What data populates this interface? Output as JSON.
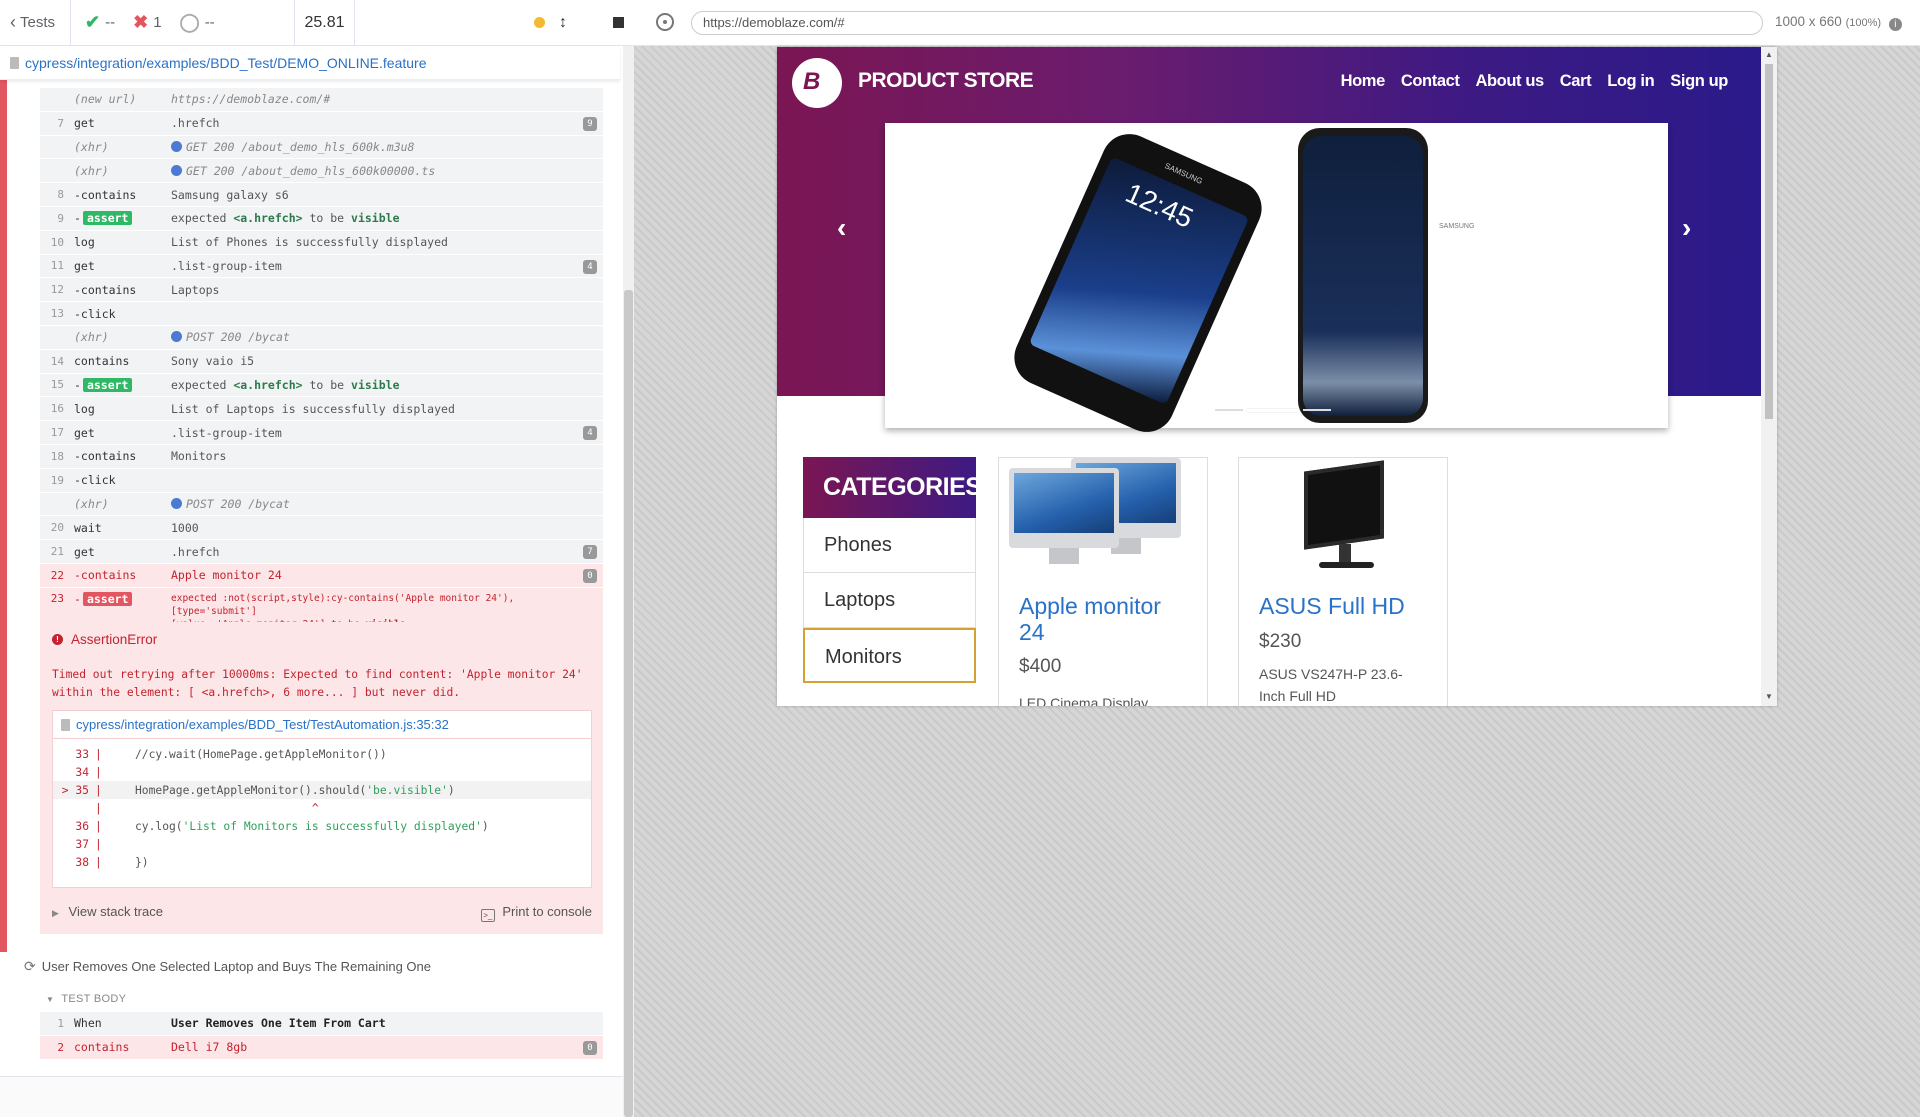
{
  "reporter": {
    "header": {
      "back_label": "Tests",
      "passed": "--",
      "failed": "1",
      "pending": "--",
      "duration": "25.81"
    },
    "spec_path": "cypress/integration/examples/BDD_Test/DEMO_ONLINE.feature",
    "commands": [
      {
        "num": "",
        "name": "(new url)",
        "msg": "https://demoblaze.com/#",
        "style": "it"
      },
      {
        "num": "7",
        "name": "get",
        "msg": ".hrefch",
        "badge": "9"
      },
      {
        "num": "",
        "name": "(xhr)",
        "msg": "GET 200 /about_demo_hls_600k.m3u8",
        "style": "xhr"
      },
      {
        "num": "",
        "name": "(xhr)",
        "msg": "GET 200 /about_demo_hls_600k00000.ts",
        "style": "xhr"
      },
      {
        "num": "8",
        "name": "-contains",
        "msg": "Samsung galaxy s6"
      },
      {
        "num": "9",
        "name": "-assert",
        "msg_pre": "expected",
        "msg_el": "<a.hrefch>",
        "msg_mid": "to be",
        "msg_end": "visible",
        "style": "assert"
      },
      {
        "num": "10",
        "name": "log",
        "msg": "List of Phones is successfully displayed"
      },
      {
        "num": "11",
        "name": "get",
        "msg": ".list-group-item",
        "badge": "4"
      },
      {
        "num": "12",
        "name": "-contains",
        "msg": "Laptops"
      },
      {
        "num": "13",
        "name": "-click",
        "msg": ""
      },
      {
        "num": "",
        "name": "(xhr)",
        "msg": "POST 200 /bycat",
        "style": "xhr"
      },
      {
        "num": "14",
        "name": "contains",
        "msg": "Sony vaio i5"
      },
      {
        "num": "15",
        "name": "-assert",
        "msg_pre": "expected",
        "msg_el": "<a.hrefch>",
        "msg_mid": "to be",
        "msg_end": "visible",
        "style": "assert"
      },
      {
        "num": "16",
        "name": "log",
        "msg": "List of Laptops is successfully displayed"
      },
      {
        "num": "17",
        "name": "get",
        "msg": ".list-group-item",
        "badge": "4"
      },
      {
        "num": "18",
        "name": "-contains",
        "msg": "Monitors"
      },
      {
        "num": "19",
        "name": "-click",
        "msg": ""
      },
      {
        "num": "",
        "name": "(xhr)",
        "msg": "POST 200 /bycat",
        "style": "xhr"
      },
      {
        "num": "20",
        "name": "wait",
        "msg": "1000"
      },
      {
        "num": "21",
        "name": "get",
        "msg": ".hrefch",
        "badge": "7"
      },
      {
        "num": "22",
        "name": "-contains",
        "msg": "Apple monitor 24",
        "badge": "0",
        "style": "fail"
      }
    ],
    "fail_assert": {
      "num": "23",
      "name": "-assert",
      "line1": "expected :not(script,style):cy-contains('Apple monitor 24'), [type='submit']",
      "line2_pre": "[value~='Apple monitor 24']",
      "line2_mid": "to be",
      "line2_end": "visible"
    },
    "error": {
      "title": "AssertionError",
      "message": "Timed out retrying after 10000ms: Expected to find content: 'Apple monitor 24' within the element: [ <a.hrefch>, 6 more... ] but never did.",
      "file": "cypress/integration/examples/BDD_Test/TestAutomation.js:35:32",
      "code_lines": [
        {
          "ln": "33",
          "code": "//cy.wait(HomePage.getAppleMonitor())"
        },
        {
          "ln": "34",
          "code": ""
        },
        {
          "ln": "35",
          "code": "HomePage.getAppleMonitor().should('be.visible')",
          "marker": ">"
        },
        {
          "ln": "",
          "code": "                          ^"
        },
        {
          "ln": "36",
          "code": "cy.log('List of Monitors is successfully displayed')"
        },
        {
          "ln": "37",
          "code": ""
        },
        {
          "ln": "38",
          "code": "})"
        }
      ],
      "stack_label": "View stack trace",
      "print_label": "Print to console"
    },
    "next_test": {
      "title": "User Removes One Selected Laptop and Buys The Remaining One",
      "body_label": "TEST BODY",
      "commands": [
        {
          "num": "1",
          "name": "When",
          "msg": "User Removes One Item From Cart"
        },
        {
          "num": "2",
          "name": "contains",
          "msg": "Dell i7 8gb",
          "badge": "0",
          "style": "fail"
        }
      ]
    }
  },
  "aut": {
    "url": "https://demoblaze.com/#",
    "viewport": "1000 x 660",
    "zoom": "(100%)"
  },
  "store": {
    "brand": "PRODUCT STORE",
    "logo_letter": "B",
    "nav": [
      "Home",
      "Contact",
      "About us",
      "Cart",
      "Log in",
      "Sign up"
    ],
    "carousel": {
      "clock": "12:45",
      "brand1": "SAMSUNG",
      "brand2": "SAMSUNG"
    },
    "categories": {
      "title": "CATEGORIES",
      "items": [
        "Phones",
        "Laptops",
        "Monitors"
      ],
      "active": "Monitors"
    },
    "products": [
      {
        "title": "Apple monitor 24",
        "price": "$400",
        "desc": "LED Cinema Display"
      },
      {
        "title": "ASUS Full HD",
        "price": "$230",
        "desc": "ASUS VS247H-P 23.6-Inch Full HD"
      }
    ]
  },
  "colors": {
    "fail": "#e25660",
    "pass": "#2fb865",
    "link": "#2a72c7",
    "brand_purple": "#7b1653",
    "brand_blue": "#3d1a83"
  }
}
